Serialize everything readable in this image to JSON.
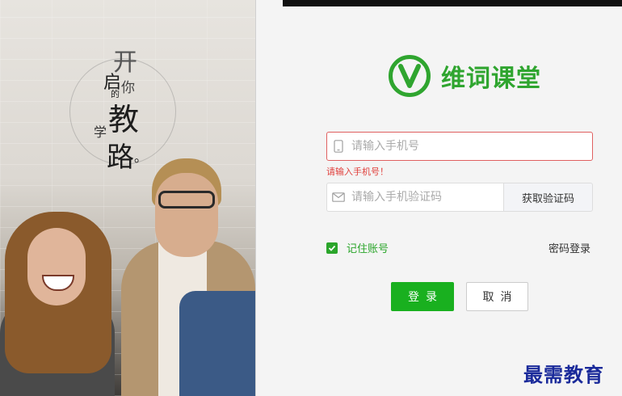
{
  "hero": {
    "slogan": [
      "开",
      "启",
      "你",
      "的",
      "教",
      "学",
      "路",
      "。"
    ]
  },
  "brand": {
    "name": "维词课堂",
    "logo_letter": "V",
    "color": "#2fa52f"
  },
  "form": {
    "phone_placeholder": "请输入手机号",
    "phone_value": "",
    "phone_error": "请输入手机号！",
    "code_placeholder": "请输入手机验证码",
    "code_value": "",
    "get_code_label": "获取验证码",
    "remember_label": "记住账号",
    "remember_checked": true,
    "password_login_label": "密码登录",
    "login_label": "登录",
    "cancel_label": "取消"
  },
  "colors": {
    "primary_green": "#19b01f",
    "error_red": "#e0403c"
  },
  "icons": {
    "phone": "phone-icon",
    "mail": "mail-icon",
    "check": "checkmark-icon"
  },
  "watermark": "最需教育"
}
